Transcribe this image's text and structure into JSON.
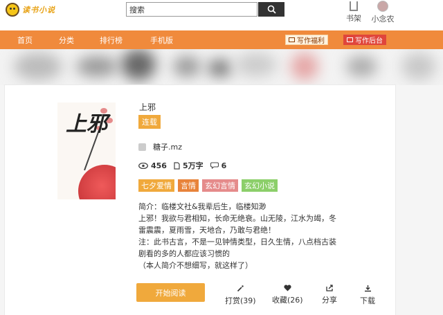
{
  "header": {
    "logo_text": "读书小说",
    "search": {
      "placeholder": "搜索",
      "value": "搜索"
    },
    "shelf_label": "书架",
    "user_label": "小念农"
  },
  "nav": {
    "items": [
      {
        "label": "首页"
      },
      {
        "label": "分类"
      },
      {
        "label": "排行榜"
      },
      {
        "label": "手机版"
      }
    ],
    "write_welfare_label": "写作福利",
    "write_backend_label": "写作后台"
  },
  "book": {
    "title": "上邪",
    "status": "连载",
    "author": "糖子.mz",
    "views": "456",
    "words": "5万字",
    "comments": "6",
    "tags": [
      {
        "label": "七夕爱情",
        "color": "#f0a93c"
      },
      {
        "label": "言情",
        "color": "#e8833a"
      },
      {
        "label": "玄幻言情",
        "color": "#e58b8b"
      },
      {
        "label": "玄幻小说",
        "color": "#8ccf6a"
      }
    ],
    "intro_lines": [
      "简介：临楼文社&我辈后生，临楼知渺",
      "上邪！我欲与君相知，长命无绝衰。山无陵，江水为竭，冬",
      "雷震震，夏雨雪，天地合，乃敢与君绝！",
      "注：此书古言，不是一见钟情类型，日久生情，八点档古装",
      "剧看的多的人都应该习惯的",
      "（本人简介不想细写，就这样了）"
    ],
    "cover_text": "上邪"
  },
  "actions": {
    "read_label": "开始阅读",
    "tip_label": "打赏(39)",
    "favorite_label": "收藏(26)",
    "share_label": "分享",
    "download_label": "下载"
  },
  "colors": {
    "nav_bg": "#f08a3c",
    "accent": "#f0a93c",
    "welfare_btn": "#fff3e0",
    "backend_btn": "#e0453b"
  }
}
